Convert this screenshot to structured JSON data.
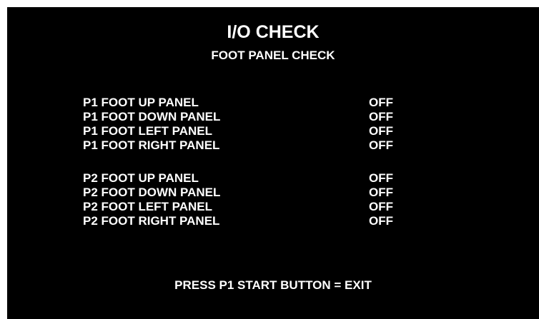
{
  "screen": {
    "title": "I/O CHECK",
    "subtitle": "FOOT PANEL CHECK",
    "footer": "PRESS P1 START BUTTON = EXIT",
    "background_color": "#000000",
    "text_color": "#ffffff"
  },
  "p1_panels": [
    {
      "label": "P1 FOOT UP PANEL",
      "state": "OFF"
    },
    {
      "label": "P1 FOOT DOWN PANEL",
      "state": "OFF"
    },
    {
      "label": "P1 FOOT LEFT PANEL",
      "state": "OFF"
    },
    {
      "label": "P1 FOOT RIGHT PANEL",
      "state": "OFF"
    }
  ],
  "p2_panels": [
    {
      "label": "P2 FOOT UP PANEL",
      "state": "OFF"
    },
    {
      "label": "P2 FOOT DOWN PANEL",
      "state": "OFF"
    },
    {
      "label": "P2 FOOT LEFT PANEL",
      "state": "OFF"
    },
    {
      "label": "P2 FOOT RIGHT PANEL",
      "state": "OFF"
    }
  ]
}
